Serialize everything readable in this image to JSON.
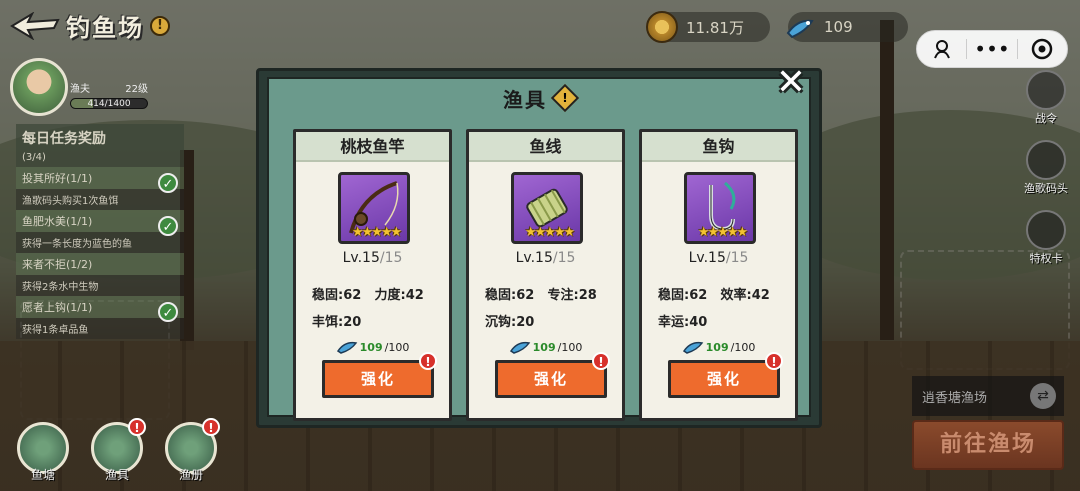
{
  "header": {
    "title": "钓鱼场",
    "info_icon": "!"
  },
  "currencies": {
    "coins": "11.81万",
    "bait": "109"
  },
  "capsule": {
    "icons": [
      "octopus-icon",
      "more-icon",
      "record-icon"
    ]
  },
  "player": {
    "role": "渔夫",
    "level": "22级",
    "xp_text": "414/1400",
    "xp_fraction": 0.296,
    "help": "?"
  },
  "tasks": {
    "title": "每日任务奖励",
    "count": "(3/4)",
    "items": [
      {
        "name": "投其所好(1/1)",
        "desc": "渔歌码头购买1次鱼饵",
        "done": true
      },
      {
        "name": "鱼肥水美(1/1)",
        "desc": "获得一条长度为蓝色的鱼",
        "done": true
      },
      {
        "name": "来者不拒(1/2)",
        "desc": "获得2条水中生物",
        "done": false
      },
      {
        "name": "愿者上钩(1/1)",
        "desc": "获得1条卓品鱼",
        "done": true
      }
    ]
  },
  "bottom_nav": [
    {
      "label": "鱼塘",
      "badge": ""
    },
    {
      "label": "渔具",
      "badge": "!"
    },
    {
      "label": "渔册",
      "badge": "!"
    }
  ],
  "right_menu": [
    {
      "label": "战令"
    },
    {
      "label": "渔歌码头"
    },
    {
      "label": "特权卡"
    }
  ],
  "pond": {
    "name": "逍香塘渔场",
    "switch_icon": "⇄",
    "goto_label": "前往渔场"
  },
  "modal": {
    "title": "渔具",
    "warn": "!",
    "close": "✕",
    "cards": [
      {
        "name": "桃枝鱼竿",
        "icon": "fishing-rod-icon",
        "stars": "★★★★★",
        "level": "Lv.15",
        "level_max": "/15",
        "stats": [
          "稳固:62",
          "力度:42",
          "丰饵:20"
        ],
        "cost_have": "109",
        "cost_need": "/100",
        "button": "强化",
        "badge": "!"
      },
      {
        "name": "鱼线",
        "icon": "fishing-line-spool-icon",
        "stars": "★★★★★",
        "level": "Lv.15",
        "level_max": "/15",
        "stats": [
          "稳固:62",
          "专注:28",
          "沉钩:20"
        ],
        "cost_have": "109",
        "cost_need": "/100",
        "button": "强化",
        "badge": "!"
      },
      {
        "name": "鱼钩",
        "icon": "fish-hook-icon",
        "stars": "★★★★★",
        "level": "Lv.15",
        "level_max": "/15",
        "stats": [
          "稳固:62",
          "效率:42",
          "幸运:40"
        ],
        "cost_have": "109",
        "cost_need": "/100",
        "button": "强化",
        "badge": "!"
      }
    ]
  }
}
